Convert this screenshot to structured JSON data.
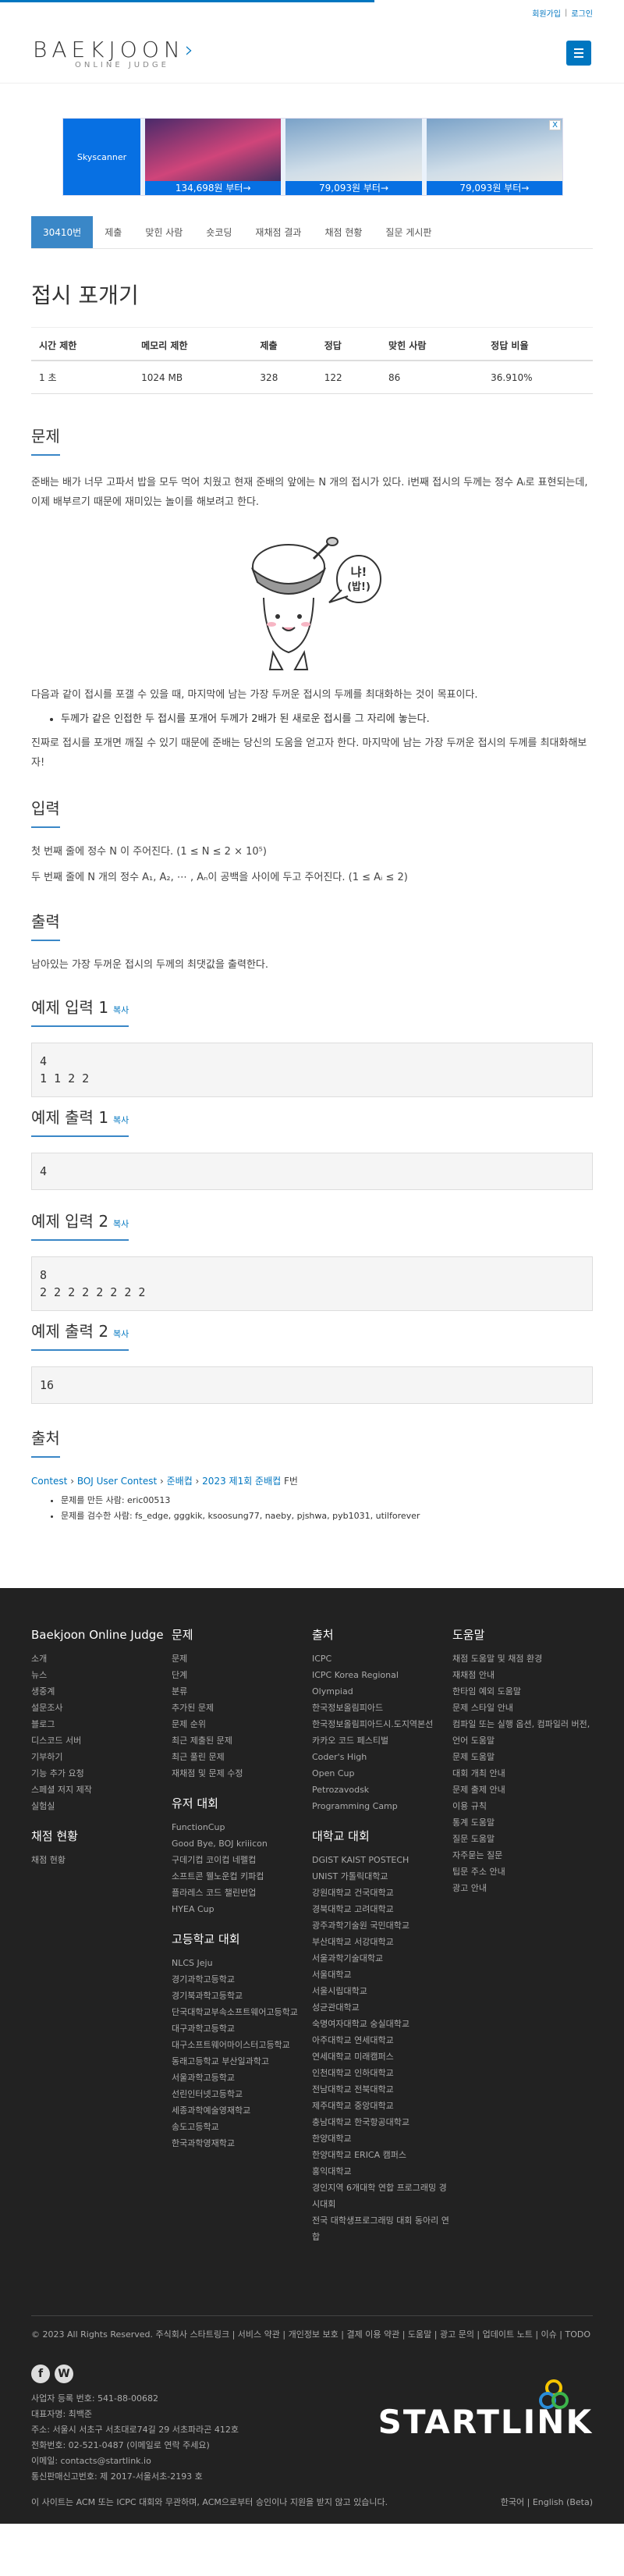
{
  "top_links": [
    "회원가입",
    "로그인"
  ],
  "logo": {
    "main": "BAEKJOON",
    "sub": "ONLINE JUDGE"
  },
  "ad": {
    "brand": "Skyscanner",
    "prices": [
      "134,698원 부터→",
      "79,093원 부터→",
      "79,093원 부터→"
    ],
    "close": "X"
  },
  "tabs": [
    "30410번",
    "제출",
    "맞힌 사람",
    "숏코딩",
    "재채점 결과",
    "채점 현황",
    "질문 게시판"
  ],
  "title": "접시 포개기",
  "info_table": {
    "headers": [
      "시간 제한",
      "메모리 제한",
      "제출",
      "정답",
      "맞힌 사람",
      "정답 비율"
    ],
    "values": [
      "1 초",
      "1024 MB",
      "328",
      "122",
      "86",
      "36.910%"
    ]
  },
  "problem": {
    "heading": "문제",
    "p1": "준배는 배가 너무 고파서 밥을 모두 먹어 치웠고 현재 준배의 앞에는 N 개의 접시가 있다. i번째 접시의 두께는 정수 Aᵢ로 표현되는데, 이제 배부르기 때문에 재미있는 놀이를 해보려고 한다.",
    "bubble": "냐! (밥!)",
    "p2": "다음과 같이 접시를 포갤 수 있을 때, 마지막에 남는 가장 두꺼운 접시의 두께를 최대화하는 것이 목표이다.",
    "bullet": "두께가 같은 인접한 두 접시를 포개어 두께가 2배가 된 새로운 접시를 그 자리에 놓는다.",
    "p3": "진짜로 접시를 포개면 깨질 수 있기 때문에 준배는 당신의 도움을 얻고자 한다. 마지막에 남는 가장 두꺼운 접시의 두께를 최대화해보자!"
  },
  "input": {
    "heading": "입력",
    "p1": "첫 번째 줄에 정수 N 이 주어진다. (1 ≤ N  ≤ 2 × 10⁵)",
    "p2": "두 번째 줄에 N 개의 정수 A₁, A₂, ⋯ , Aₙ이 공백을 사이에 두고 주어진다. (1 ≤ Aᵢ ≤ 2)"
  },
  "output": {
    "heading": "출력",
    "p1": "남아있는 가장 두꺼운 접시의 두께의 최댓값을 출력한다."
  },
  "samples": [
    {
      "heading": "예제 입력 1",
      "copy": "복사",
      "content": "4\n1 1 2 2"
    },
    {
      "heading": "예제 출력 1",
      "copy": "복사",
      "content": "4"
    },
    {
      "heading": "예제 입력 2",
      "copy": "복사",
      "content": "8\n2 2 2 2 2 2 2 2"
    },
    {
      "heading": "예제 출력 2",
      "copy": "복사",
      "content": "16"
    }
  ],
  "source": {
    "heading": "출처",
    "breadcrumb": [
      "Contest",
      "BOJ User Contest",
      "준배컵",
      "2023 제1회 준배컵"
    ],
    "suffix": "F번",
    "made_by": "문제를 만든 사람: eric00513",
    "checked_by": "문제를 검수한 사람: fs_edge, gggkik, ksoosung77, naeby, pjshwa, pyb1031, utilforever"
  },
  "footer": {
    "columns": [
      {
        "title": "Baekjoon Online Judge",
        "items": [
          "소개",
          "뉴스",
          "생중계",
          "설문조사",
          "블로그",
          "디스코드 서버",
          "기부하기",
          "기능 추가 요청",
          "스페셜 저지 제작",
          "실험실"
        ],
        "title2": "채점 현황",
        "items2": [
          "채점 현황"
        ]
      },
      {
        "title": "문제",
        "items": [
          "문제",
          "단계",
          "분류",
          "추가된 문제",
          "문제 순위",
          "최근 제출된 문제",
          "최근 풀린 문제",
          "재채점 및 문제 수정"
        ],
        "title2": "유저 대회",
        "items2": [
          "FunctionCup",
          "Good Bye, BOJ kriiicon",
          "구데기컵 코이컵 네펠컵",
          "소프트콘 웰노운컵 키파컵",
          "플라레스 코드 챌린번업",
          "HYEA Cup"
        ],
        "title3": "고등학교 대회",
        "items3": [
          "NLCS Jeju",
          "경기과학고등학교",
          "경기북과학고등학교",
          "단국대학교부속소프트웨어고등학교",
          "대구과학고등학교",
          "대구소프트웨어마이스터고등학교",
          "동래고등학교 부산일과학고",
          "서울과학고등학교",
          "선린인터넷고등학교",
          "세종과학예술영재학교",
          "송도고등학교",
          "한국과학영재학교"
        ]
      },
      {
        "title": "출처",
        "items": [
          "ICPC",
          "ICPC Korea Regional",
          "Olympiad",
          "한국정보올림피아드",
          "한국정보올림피아드시.도지역본선",
          "카카오 코드 페스티벌",
          "Coder's High",
          "Open Cup",
          "Petrozavodsk",
          "Programming Camp"
        ],
        "title2": "대학교 대회",
        "items2": [
          "DGIST KAIST POSTECH",
          "UNIST 가톨릭대학교",
          "강원대학교 건국대학교",
          "경북대학교 고려대학교",
          "광주과학기술원 국민대학교",
          "부산대학교 서강대학교",
          "서울과학기술대학교",
          "서울대학교",
          "서울시립대학교",
          "성균관대학교",
          "숙명여자대학교 숭실대학교",
          "아주대학교 연세대학교",
          "연세대학교 미래캠퍼스",
          "인천대학교 인하대학교",
          "전남대학교 전북대학교",
          "제주대학교 중앙대학교",
          "충남대학교 한국항공대학교",
          "한양대학교",
          "한양대학교 ERICA 캠퍼스",
          "홍익대학교",
          "경인지역 6개대학 연합 프로그래밍 경시대회",
          "전국 대학생프로그래밍 대회 동아리 연합"
        ]
      },
      {
        "title": "도움말",
        "items": [
          "채점 도움말 및 채점 환경",
          "재채점 안내",
          "한타임 예외 도움말",
          "문제 스타일 안내",
          "컴파일 또는 실행 옵션, 컴파일러 버전, 언어 도움말",
          "문제 도움말",
          "대회 개최 안내",
          "문제 출제 안내",
          "이용 규칙",
          "통계 도움말",
          "질문 도움말",
          "자주묻는 질문",
          "팁문 주소 안내",
          "광고 안내"
        ]
      }
    ],
    "bottom_links": "© 2023 All Rights Reserved. 주식회사 스타트링크 | 서비스 약관 | 개인정보 보호 | 결제 이용 약관 | 도움말 | 광고 문의 | 업데이트 노트 | 이슈 | TODO",
    "biz": [
      "사업자 등록 번호: 541-88-00682",
      "대표자명: 최백준",
      "주소: 서울시 서초구 서초대로74길 29 서초파라곤 412호",
      "전화번호: 02-521-0487 (이메일로 연락 주세요)",
      "이메일: contacts@startlink.io",
      "통신판매신고번호: 제 2017-서울서초-2193 호"
    ],
    "brand": "STARTLINK",
    "disclaimer": "이 사이트는 ACM 또는 ICPC 대회와 무관하며, ACM으로부터 승인이나 지원을 받지 않고 있습니다.",
    "lang": "한국어 | English (Beta)"
  }
}
